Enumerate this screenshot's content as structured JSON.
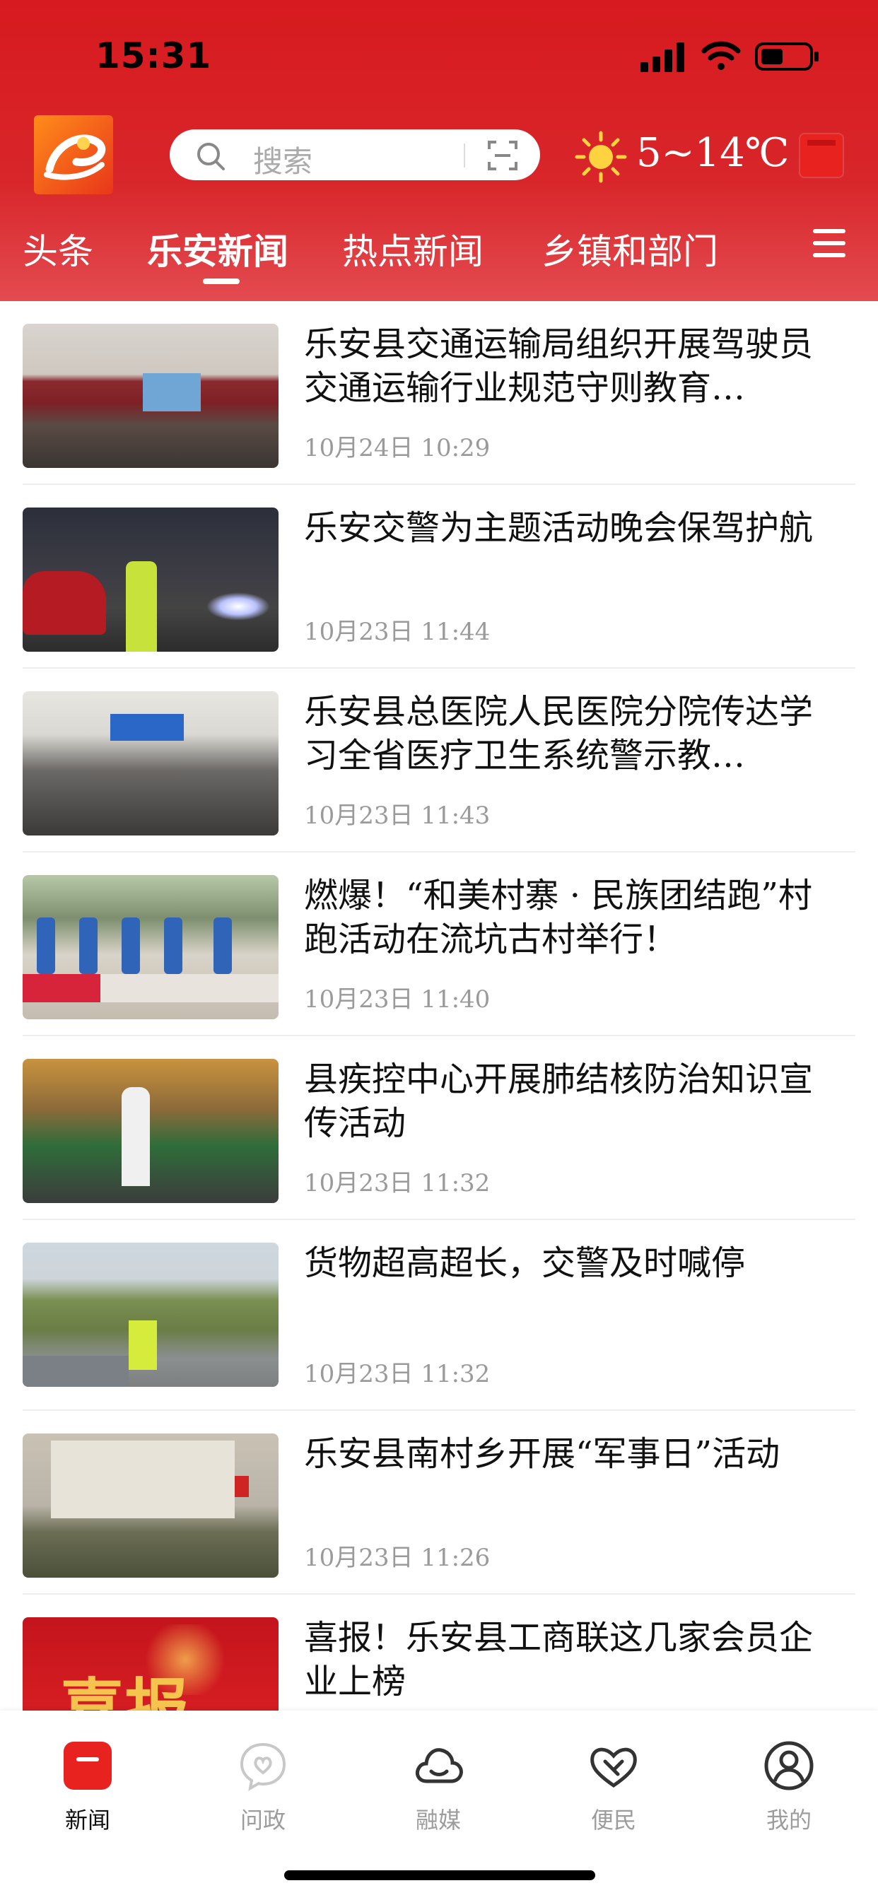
{
  "status_bar": {
    "time": "15:31"
  },
  "header": {
    "search_placeholder": "搜索",
    "weather": "5~14℃",
    "tabs": [
      {
        "label": "头条",
        "active": false
      },
      {
        "label": "乐安新闻",
        "active": true
      },
      {
        "label": "热点新闻",
        "active": false
      },
      {
        "label": "乡镇和部门",
        "active": false
      }
    ]
  },
  "news": [
    {
      "title": "乐安县交通运输局组织开展驾驶员交通运输行业规范守则教育…",
      "time": "10月24日  10:29"
    },
    {
      "title": "乐安交警为主题活动晚会保驾护航",
      "time": "10月23日  11:44"
    },
    {
      "title": "乐安县总医院人民医院分院传达学习全省医疗卫生系统警示教…",
      "time": "10月23日  11:43"
    },
    {
      "title": "燃爆！“和美村寨 · 民族团结跑”村跑活动在流坑古村举行！",
      "time": "10月23日  11:40"
    },
    {
      "title": "县疾控中心开展肺结核防治知识宣传活动",
      "time": "10月23日  11:32"
    },
    {
      "title": "货物超高超长，交警及时喊停",
      "time": "10月23日  11:32"
    },
    {
      "title": "乐安县南村乡开展“军事日”活动",
      "time": "10月23日  11:26"
    },
    {
      "title": "喜报！乐安县工商联这几家会员企业上榜",
      "time": ""
    }
  ],
  "thumb_texts": {
    "item8": "喜报"
  },
  "bottom_nav": [
    {
      "label": "新闻",
      "icon": "news-icon",
      "active": true
    },
    {
      "label": "问政",
      "icon": "chat-heart-icon",
      "active": false
    },
    {
      "label": "融媒",
      "icon": "cloud-icon",
      "active": false
    },
    {
      "label": "便民",
      "icon": "handshake-heart-icon",
      "active": false
    },
    {
      "label": "我的",
      "icon": "user-icon",
      "active": false
    }
  ],
  "colors": {
    "brand_red": "#d71a1f",
    "time_gray": "#9a9a9a",
    "nav_active": "#e8221f"
  }
}
